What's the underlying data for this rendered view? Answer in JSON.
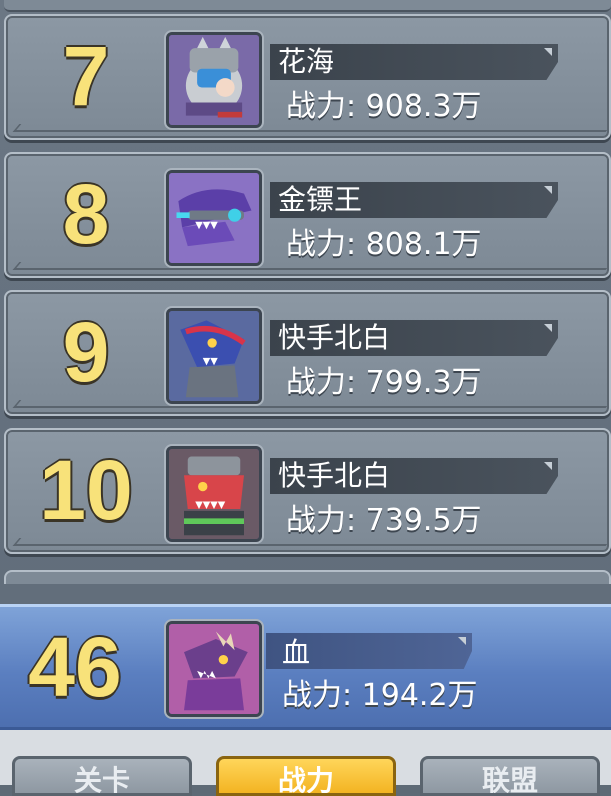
{
  "leaderboard": {
    "rows": [
      {
        "rank": "7",
        "name": "花海",
        "power": "战力: 908.3万"
      },
      {
        "rank": "8",
        "name": "金镖王",
        "power": "战力: 808.1万"
      },
      {
        "rank": "9",
        "name": "快手北白",
        "power": "战力: 799.3万"
      },
      {
        "rank": "10",
        "name": "快手北白",
        "power": "战力: 739.5万"
      }
    ],
    "self": {
      "rank": "46",
      "name": "血",
      "power": "战力:  194.2万"
    }
  },
  "tabs": [
    {
      "label": "关卡",
      "active": false
    },
    {
      "label": "战力",
      "active": true
    },
    {
      "label": "联盟",
      "active": false
    }
  ],
  "colors": {
    "rank_text": "#f8e27a",
    "self_row": "#5b7fc0",
    "active_tab": "#f3b422"
  },
  "icons": {
    "avatar_7": "armored-robot-dragon-icon",
    "avatar_8": "purple-dragon-gunner-icon",
    "avatar_9": "blue-dragon-knight-icon",
    "avatar_10": "red-dragon-soldier-icon",
    "avatar_self": "bone-dragon-icon"
  }
}
